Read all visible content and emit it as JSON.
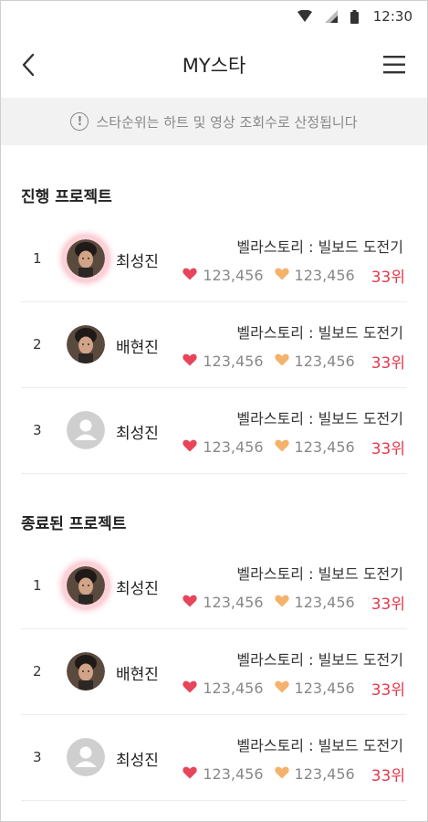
{
  "status": {
    "time": "12:30"
  },
  "header": {
    "title": "MY스타"
  },
  "notice": {
    "text": "스타순위는 하트 및 영상 조회수로 산정됩니다"
  },
  "sections": [
    {
      "title": "진행 프로젝트",
      "rows": [
        {
          "rank": "1",
          "name": "최성진",
          "avatar": "photo-glow",
          "project": "벨라스토리 : 빌보드 도전기",
          "hearts": "123,456",
          "views": "123,456",
          "ranking": "33위"
        },
        {
          "rank": "2",
          "name": "배현진",
          "avatar": "photo",
          "project": "벨라스토리 : 빌보드 도전기",
          "hearts": "123,456",
          "views": "123,456",
          "ranking": "33위"
        },
        {
          "rank": "3",
          "name": "최성진",
          "avatar": "placeholder",
          "project": "벨라스토리 : 빌보드 도전기",
          "hearts": "123,456",
          "views": "123,456",
          "ranking": "33위"
        }
      ]
    },
    {
      "title": "종료된 프로젝트",
      "rows": [
        {
          "rank": "1",
          "name": "최성진",
          "avatar": "photo-glow",
          "project": "벨라스토리 : 빌보드 도전기",
          "hearts": "123,456",
          "views": "123,456",
          "ranking": "33위"
        },
        {
          "rank": "2",
          "name": "배현진",
          "avatar": "photo",
          "project": "벨라스토리 : 빌보드 도전기",
          "hearts": "123,456",
          "views": "123,456",
          "ranking": "33위"
        },
        {
          "rank": "3",
          "name": "최성진",
          "avatar": "placeholder",
          "project": "벨라스토리 : 빌보드 도전기",
          "hearts": "123,456",
          "views": "123,456",
          "ranking": "33위"
        }
      ]
    }
  ],
  "colors": {
    "heart_red": "#e8455b",
    "heart_orange": "#f5b26b",
    "rank_red": "#e23a4b",
    "notice_bg": "#f2f2f2"
  }
}
